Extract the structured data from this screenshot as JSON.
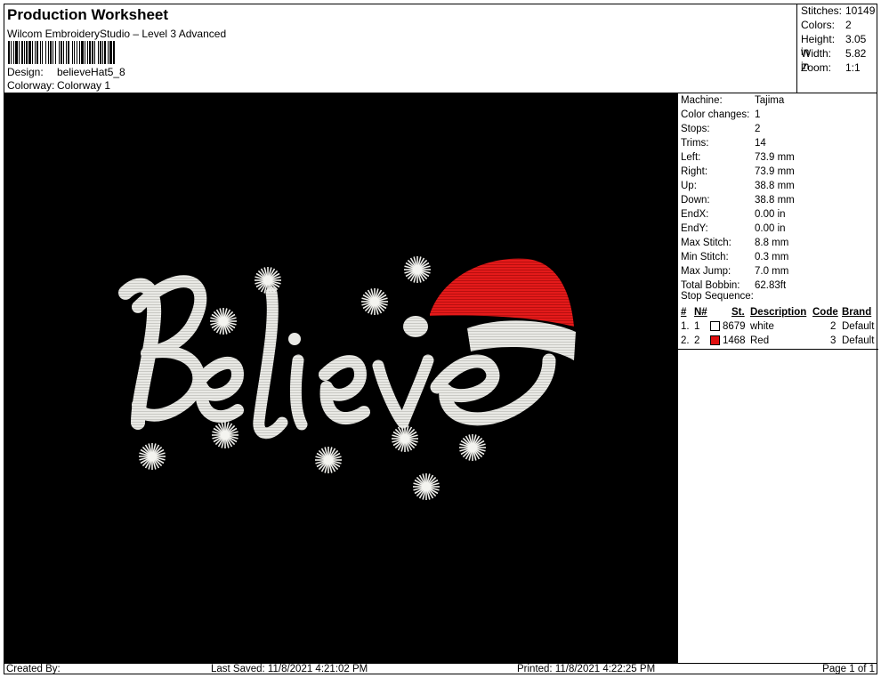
{
  "header": {
    "title": "Production Worksheet",
    "subtitle": "Wilcom EmbroideryStudio – Level 3 Advanced",
    "design_label": "Design:",
    "design_value": "believeHat5_8",
    "colorway_label": "Colorway:",
    "colorway_value": "Colorway 1"
  },
  "summary": {
    "stitches_label": "Stitches:",
    "stitches_value": "10149",
    "colors_label": "Colors:",
    "colors_value": "2",
    "height_label": "Height:",
    "height_value": "3.05 in",
    "width_label": "Width:",
    "width_value": "5.82 in",
    "zoom_label": "Zoom:",
    "zoom_value": "1:1"
  },
  "info": {
    "machine_label": "Machine:",
    "machine_value": "Tajima",
    "color_changes_label": "Color changes:",
    "color_changes_value": "1",
    "stops_label": "Stops:",
    "stops_value": "2",
    "trims_label": "Trims:",
    "trims_value": "14",
    "left_label": "Left:",
    "left_value": "73.9 mm",
    "right_label": "Right:",
    "right_value": "73.9 mm",
    "up_label": "Up:",
    "up_value": "38.8 mm",
    "down_label": "Down:",
    "down_value": "38.8 mm",
    "endx_label": "EndX:",
    "endx_value": "0.00 in",
    "endy_label": "EndY:",
    "endy_value": "0.00 in",
    "max_stitch_label": "Max Stitch:",
    "max_stitch_value": "8.8 mm",
    "min_stitch_label": "Min Stitch:",
    "min_stitch_value": "0.3 mm",
    "max_jump_label": "Max Jump:",
    "max_jump_value": "7.0 mm",
    "total_bobbin_label": "Total Bobbin:",
    "total_bobbin_value": "62.83ft"
  },
  "stop_sequence": {
    "title": "Stop Sequence:",
    "columns": {
      "idx": "#",
      "needle": "N#",
      "stitches": "St.",
      "description": "Description",
      "code": "Code",
      "brand": "Brand"
    },
    "rows": [
      {
        "idx": "1.",
        "needle": "1",
        "stitches": "8679",
        "description": "white",
        "code": "2",
        "brand": "Default",
        "color": "#ffffff"
      },
      {
        "idx": "2.",
        "needle": "2",
        "stitches": "1468",
        "description": "Red",
        "code": "3",
        "brand": "Default",
        "color": "#e01010"
      }
    ]
  },
  "footer": {
    "created_by": "Created By:",
    "last_saved": "Last Saved: 11/8/2021 4:21:02 PM",
    "printed": "Printed: 11/8/2021 4:22:25 PM",
    "page": "Page 1 of 1"
  },
  "design_preview": {
    "text": "Believe",
    "thread_white": "#e8e8e4",
    "thread_red": "#e01818",
    "background": "#000000"
  }
}
